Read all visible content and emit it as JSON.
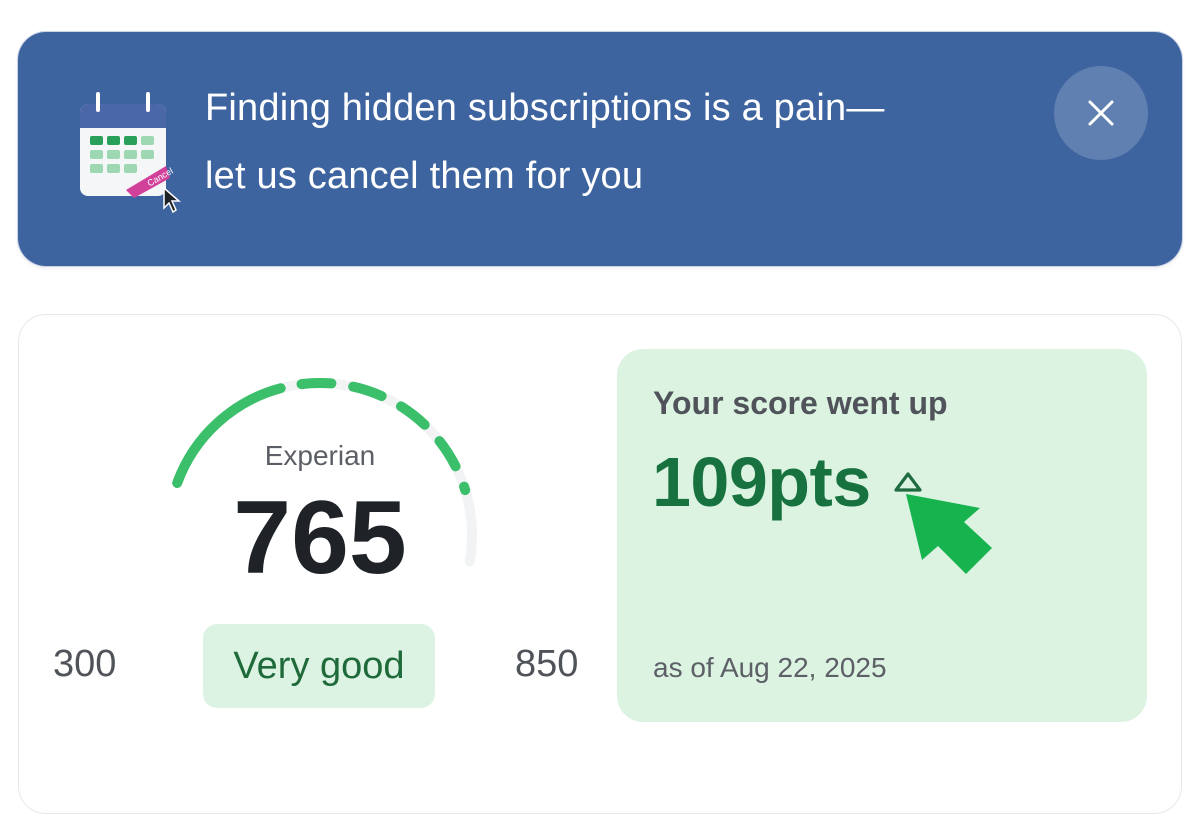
{
  "banner": {
    "line1": "Finding hidden subscriptions is a pain—",
    "line2": "let us cancel them for you",
    "icon": "calendar-cancel-icon",
    "icon_tag": "Cancel",
    "close_icon": "close-icon"
  },
  "score_card": {
    "bureau": "Experian",
    "score": "765",
    "range_min": "300",
    "range_max": "850",
    "rating": "Very good",
    "gauge_fraction": 0.84,
    "change_title": "Your score went up",
    "change_value": "109pts",
    "change_direction_icon": "triangle-up-icon",
    "as_of": "as of Aug 22, 2025"
  },
  "colors": {
    "banner_bg": "#3e64a0",
    "gauge_active": "#3cbf6b",
    "gauge_inactive": "#f2f3f4",
    "positive_text": "#17723f",
    "positive_panel": "#dcf3e2",
    "pointer_arrow": "#16b34f"
  }
}
